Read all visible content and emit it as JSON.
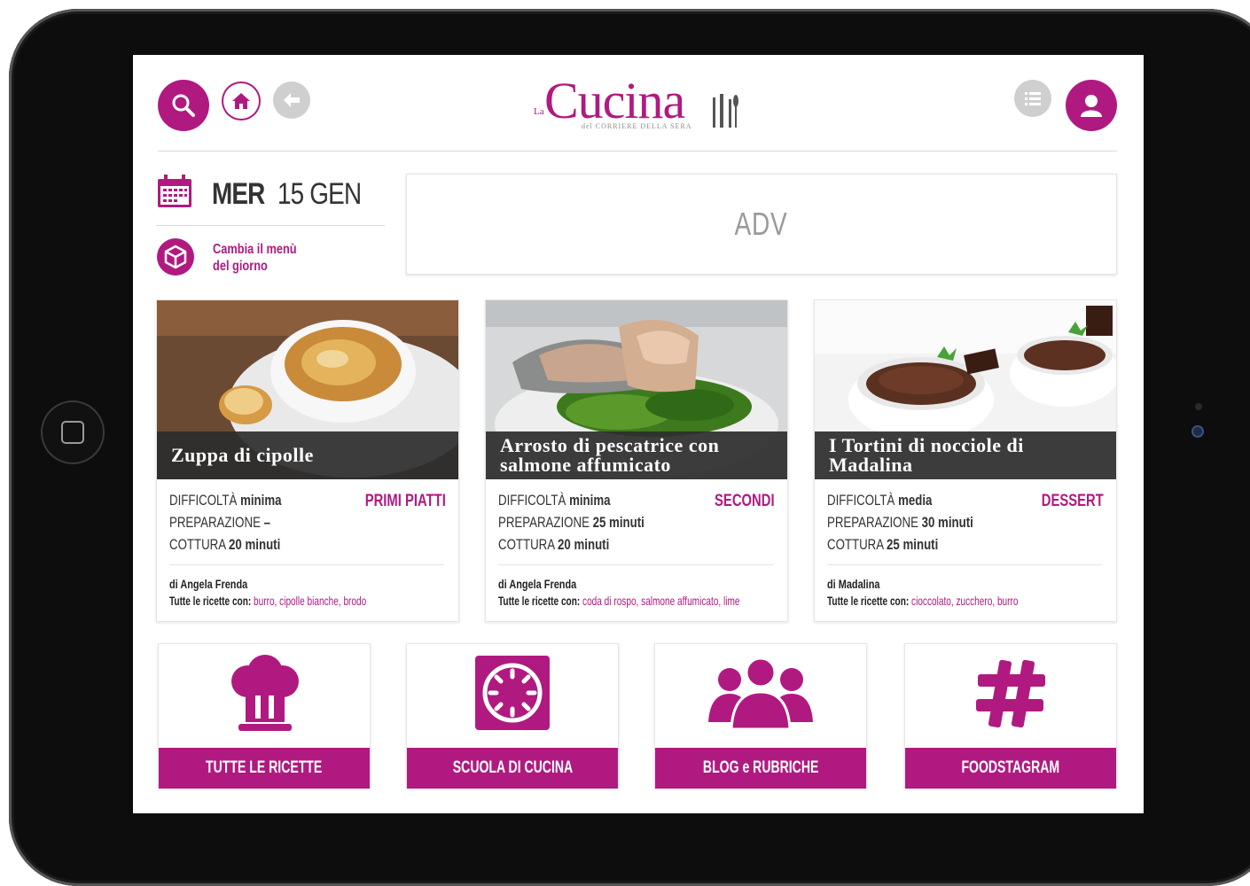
{
  "brand": {
    "prefix": "La",
    "name": "Cucina",
    "subtitle": "del CORRIERE DELLA SERA"
  },
  "colors": {
    "accent": "#b01a80",
    "icon_grey": "#cfcfcf"
  },
  "header": {
    "left_icons": [
      "search-icon",
      "home-icon",
      "back-icon"
    ],
    "right_icons": [
      "menu-list-icon",
      "user-icon"
    ]
  },
  "date": {
    "weekday": "MER",
    "day": "15 GEN"
  },
  "change_menu": {
    "label": "Cambia il menù del giorno"
  },
  "adv": {
    "label": "ADV"
  },
  "labels": {
    "difficulty": "DIFFICOLTÀ",
    "preparation": "PREPARAZIONE",
    "cooking": "COTTURA",
    "all_recipes_with": "Tutte le ricette con:"
  },
  "recipes": [
    {
      "title": "Zuppa di cipolle",
      "difficulty": "minima",
      "category": "PRIMI PIATTI",
      "preparation": "–",
      "cooking": "20 minuti",
      "author": "di Angela Frenda",
      "tags": "burro, cipolle bianche, brodo"
    },
    {
      "title": "Arrosto di pescatrice con salmone affumicato",
      "difficulty": "minima",
      "category": "SECONDI",
      "preparation": "25 minuti",
      "cooking": "20 minuti",
      "author": "di Angela Frenda",
      "tags": "coda di rospo, salmone affumicato, lime"
    },
    {
      "title": "I Tortini di nocciole di Madalina",
      "difficulty": "media",
      "category": "DESSERT",
      "preparation": "30 minuti",
      "cooking": "25 minuti",
      "author": "di Madalina",
      "tags": "cioccolato, zucchero, burro"
    }
  ],
  "tiles": [
    {
      "label": "TUTTE LE RICETTE",
      "icon": "chef-hat-icon"
    },
    {
      "label": "SCUOLA DI CUCINA",
      "icon": "timer-icon"
    },
    {
      "label": "BLOG e RUBRICHE",
      "icon": "people-icon"
    },
    {
      "label": "FOODSTAGRAM",
      "icon": "hashtag-icon"
    }
  ]
}
